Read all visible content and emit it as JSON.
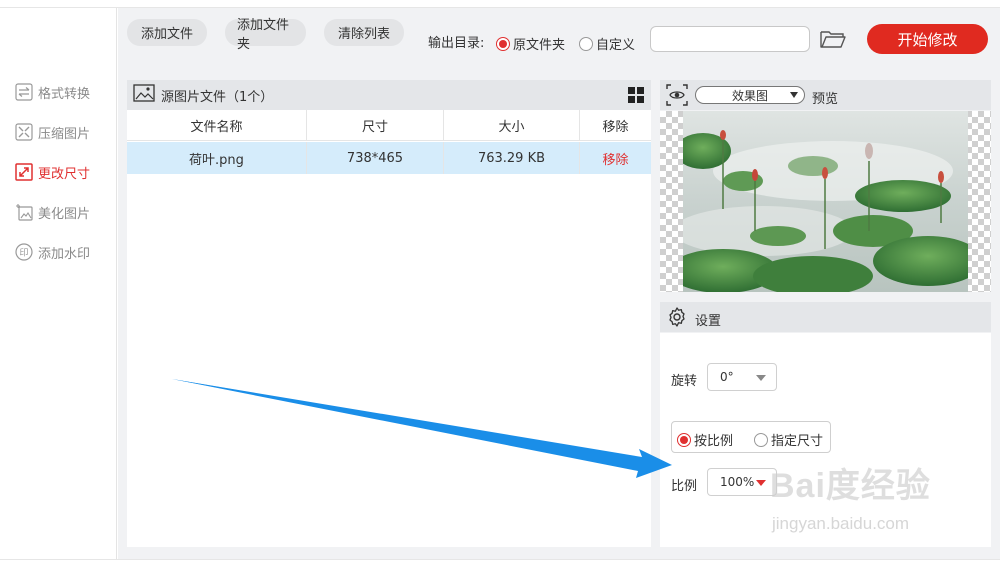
{
  "sidebar": {
    "items": [
      {
        "label": "格式转换",
        "icon": "swap-arrows-icon",
        "active": false
      },
      {
        "label": "压缩图片",
        "icon": "compress-icon",
        "active": false
      },
      {
        "label": "更改尺寸",
        "icon": "resize-icon",
        "active": true
      },
      {
        "label": "美化图片",
        "icon": "sparkle-image-icon",
        "active": false
      },
      {
        "label": "添加水印",
        "icon": "seal-icon",
        "active": false
      }
    ]
  },
  "toolbar": {
    "add_file": "添加文件",
    "add_folder": "添加文件夹",
    "clear_list": "清除列表",
    "output_label": "输出目录:",
    "radio_original": "原文件夹",
    "radio_custom": "自定义",
    "selected_output": "原文件夹",
    "path_value": "",
    "start_label": "开始修改"
  },
  "file_panel": {
    "title": "源图片文件（1个）",
    "columns": [
      "文件名称",
      "尺寸",
      "大小",
      "移除"
    ],
    "rows": [
      {
        "name": "荷叶.png",
        "size": "738*465",
        "filesize": "763.29 KB",
        "action": "移除"
      }
    ]
  },
  "preview": {
    "select_value": "效果图",
    "label": "预览"
  },
  "settings": {
    "title": "设置",
    "rotate_label": "旋转",
    "rotate_value": "0°",
    "mode_ratio": "按比例",
    "mode_size": "指定尺寸",
    "selected_mode": "按比例",
    "ratio_label": "比例",
    "ratio_value": "100%"
  },
  "watermark": {
    "brand": "Bai度经验",
    "url": "jingyan.baidu.com"
  },
  "colors": {
    "accent": "#e02a20",
    "selected_row": "#d5ecfb",
    "arrow": "#1a8ee8"
  }
}
